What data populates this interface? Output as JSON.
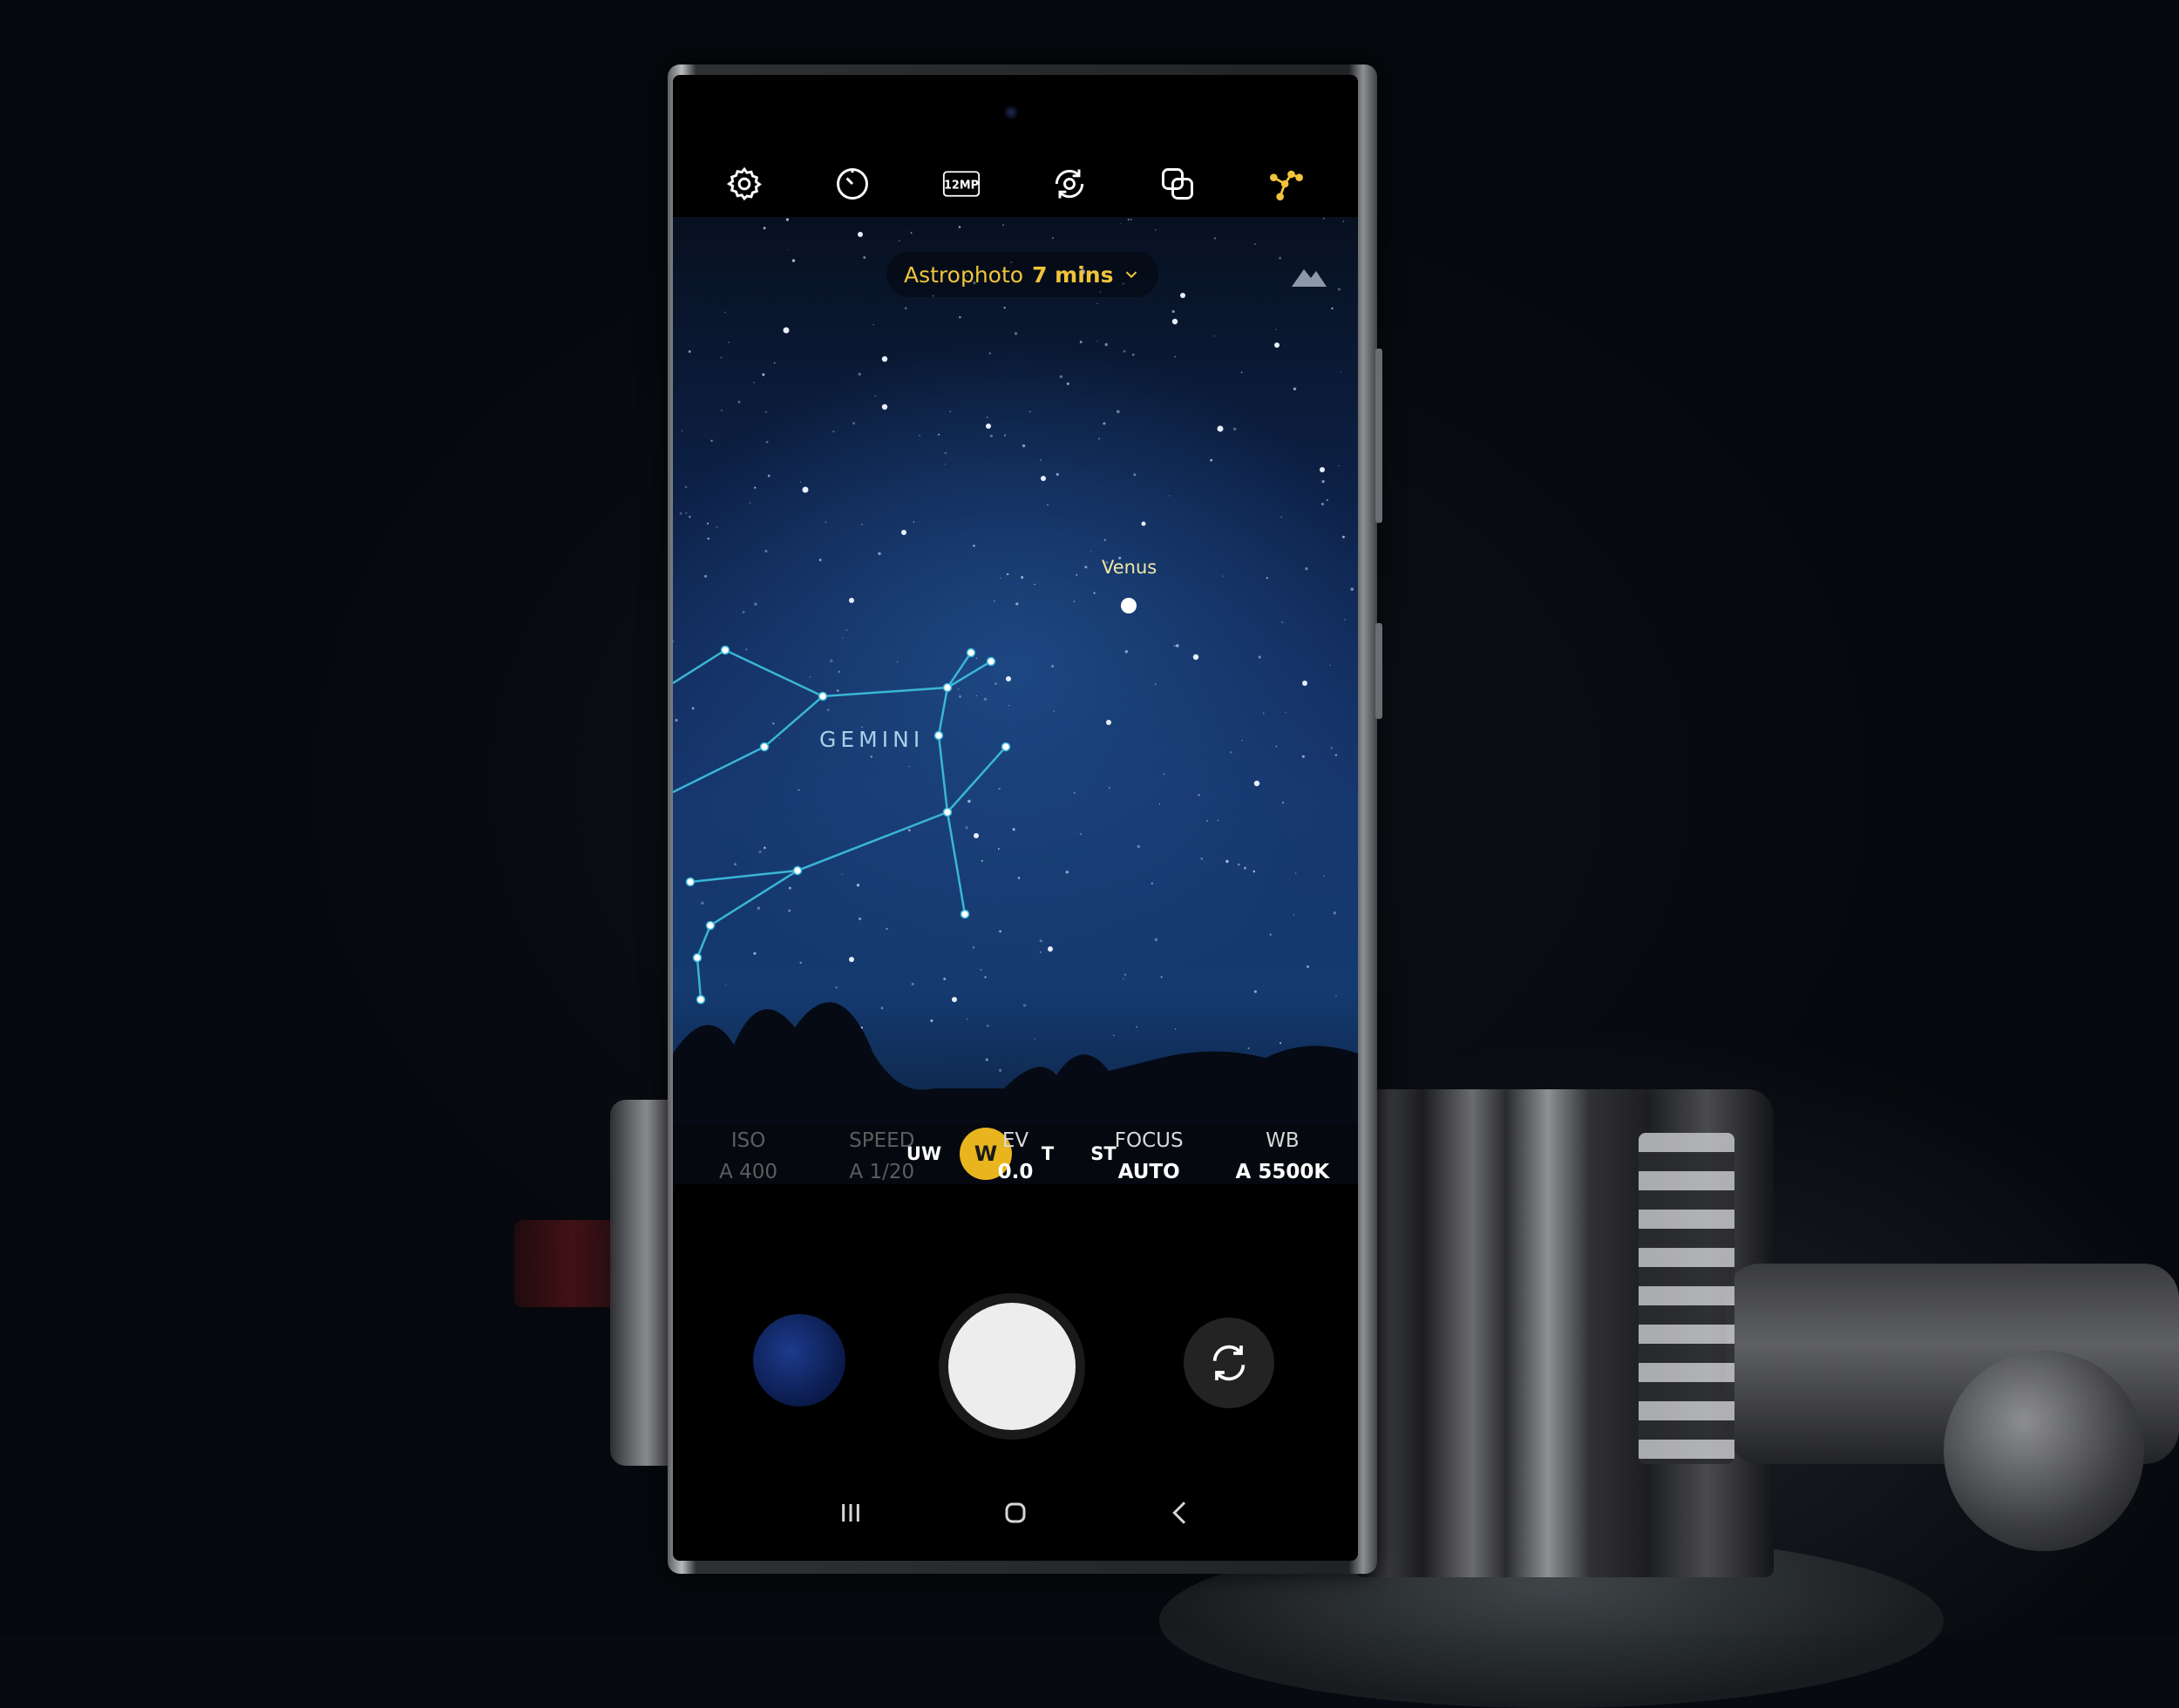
{
  "top_bar": {
    "icons": [
      "settings-icon",
      "timer-icon",
      "resolution-icon",
      "focus-mode-icon",
      "filter-icon",
      "constellation-guide-icon"
    ],
    "resolution_label": "12MP",
    "active_color": "#f0c43a"
  },
  "mode": {
    "label": "Astrophoto",
    "duration": "7 mins"
  },
  "sky": {
    "planet_label": "Venus",
    "constellation_label": "GEMINI"
  },
  "lenses": [
    {
      "label": "UW",
      "active": false
    },
    {
      "label": "W",
      "active": true
    },
    {
      "label": "T",
      "active": false
    },
    {
      "label": "ST",
      "active": false
    }
  ],
  "pro_settings": [
    {
      "label": "ISO",
      "value": "A 400",
      "dim": true
    },
    {
      "label": "SPEED",
      "value": "A 1/20",
      "dim": true
    },
    {
      "label": "EV",
      "value": "0.0",
      "dim": false
    },
    {
      "label": "FOCUS",
      "value": "AUTO",
      "dim": false
    },
    {
      "label": "WB",
      "value": "A 5500K",
      "dim": false
    }
  ],
  "controls": {
    "gallery": "gallery-thumbnail",
    "shutter": "shutter-button",
    "switch_camera": "switch-camera-icon"
  },
  "nav": [
    "recent-apps-icon",
    "home-icon",
    "back-icon"
  ]
}
